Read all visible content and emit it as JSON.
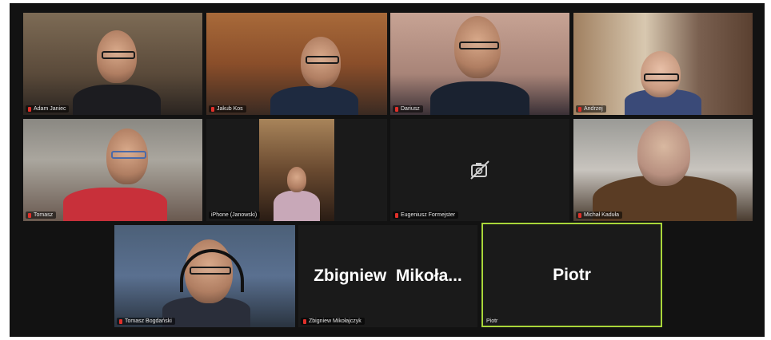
{
  "participants": [
    {
      "name": "Adam Janiec",
      "video": true
    },
    {
      "name": "Jakub Kos",
      "video": true
    },
    {
      "name": "Dariusz",
      "video": true
    },
    {
      "name": "Andrzej",
      "video": true
    },
    {
      "name": "Tomasz",
      "video": true
    },
    {
      "name": "iPhone (Janowski)",
      "video": true
    },
    {
      "name": "Eugeniusz Formejster",
      "video": false,
      "icon": "camera-off-icon"
    },
    {
      "name": "Michał Kaduła",
      "video": true
    },
    {
      "name": "Tomasz Bogdański",
      "video": true
    },
    {
      "name": "Zbigniew Mikołajczyk",
      "video": false,
      "display_name": "Zbigniew  Mikoła..."
    },
    {
      "name": "Piotr",
      "video": false,
      "display_name": "Piotr",
      "active_speaker": true
    }
  ],
  "colors": {
    "stage_background": "#121212",
    "active_speaker_border": "#a9d63a",
    "muted_mic": "#e0302a"
  }
}
